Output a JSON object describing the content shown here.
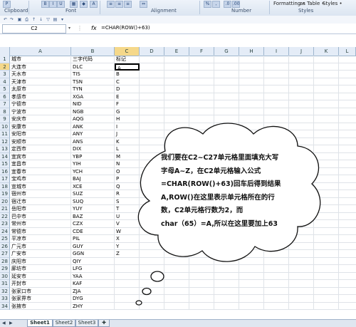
{
  "ribbon": {
    "groups": [
      "Clipboard",
      "Font",
      "Alignment",
      "Number",
      "Styles"
    ],
    "styles_items": [
      "Formatting •",
      "as Table •",
      "Styles •"
    ]
  },
  "formula_bar": {
    "name_box": "C2",
    "fx": "fx",
    "formula": "=CHAR(ROW()+63)"
  },
  "columns": [
    "A",
    "B",
    "C",
    "D",
    "E",
    "F",
    "G",
    "H",
    "I",
    "J",
    "K",
    "L"
  ],
  "rows": [
    {
      "n": "1",
      "a": "城市",
      "b": "三字代码",
      "c": "标记"
    },
    {
      "n": "2",
      "a": "大连市",
      "b": "DLC",
      "c": "A"
    },
    {
      "n": "3",
      "a": "天水市",
      "b": "TIS",
      "c": "B"
    },
    {
      "n": "4",
      "a": "天津市",
      "b": "TSN",
      "c": "C"
    },
    {
      "n": "5",
      "a": "太原市",
      "b": "TYN",
      "c": "D"
    },
    {
      "n": "6",
      "a": "孝感市",
      "b": "XGA",
      "c": "E"
    },
    {
      "n": "7",
      "a": "宁德市",
      "b": "NID",
      "c": "F"
    },
    {
      "n": "8",
      "a": "宁波市",
      "b": "NGB",
      "c": "G"
    },
    {
      "n": "9",
      "a": "安庆市",
      "b": "AQG",
      "c": "H"
    },
    {
      "n": "10",
      "a": "安康市",
      "b": "ANK",
      "c": "I"
    },
    {
      "n": "11",
      "a": "安阳市",
      "b": "ANY",
      "c": "J"
    },
    {
      "n": "12",
      "a": "安顺市",
      "b": "ANS",
      "c": "K"
    },
    {
      "n": "13",
      "a": "定西市",
      "b": "DIX",
      "c": "L"
    },
    {
      "n": "14",
      "a": "宜宾市",
      "b": "YBP",
      "c": "M"
    },
    {
      "n": "15",
      "a": "宜昌市",
      "b": "YIH",
      "c": "N"
    },
    {
      "n": "16",
      "a": "宜春市",
      "b": "YCH",
      "c": "O"
    },
    {
      "n": "17",
      "a": "宝鸡市",
      "b": "BAJ",
      "c": "P"
    },
    {
      "n": "18",
      "a": "宣城市",
      "b": "XCE",
      "c": "Q"
    },
    {
      "n": "19",
      "a": "宿州市",
      "b": "SUZ",
      "c": "R"
    },
    {
      "n": "20",
      "a": "宿迁市",
      "b": "SUQ",
      "c": "S"
    },
    {
      "n": "21",
      "a": "岳阳市",
      "b": "YUY",
      "c": "T"
    },
    {
      "n": "22",
      "a": "巴中市",
      "b": "BAZ",
      "c": "U"
    },
    {
      "n": "23",
      "a": "常州市",
      "b": "CZX",
      "c": "V"
    },
    {
      "n": "24",
      "a": "常德市",
      "b": "CDE",
      "c": "W"
    },
    {
      "n": "25",
      "a": "平凉市",
      "b": "PIL",
      "c": "X"
    },
    {
      "n": "26",
      "a": "广元市",
      "b": "GUY",
      "c": "Y"
    },
    {
      "n": "27",
      "a": "广安市",
      "b": "GGN",
      "c": "Z"
    },
    {
      "n": "28",
      "a": "庆阳市",
      "b": "QIY",
      "c": ""
    },
    {
      "n": "29",
      "a": "廊坊市",
      "b": "LFG",
      "c": ""
    },
    {
      "n": "30",
      "a": "延安市",
      "b": "YAA",
      "c": ""
    },
    {
      "n": "31",
      "a": "开封市",
      "b": "KAF",
      "c": ""
    },
    {
      "n": "32",
      "a": "张家口市",
      "b": "ZJA",
      "c": ""
    },
    {
      "n": "33",
      "a": "张家界市",
      "b": "DYG",
      "c": ""
    },
    {
      "n": "34",
      "a": "张掖市",
      "b": "ZHY",
      "c": ""
    }
  ],
  "sheets": [
    "Sheet1",
    "Sheet2",
    "Sheet3"
  ],
  "callout": {
    "lines": [
      "我们要在C2~C27单元格里面填充大写",
      "字母A~Z，在C2单元格输入公式",
      "=CHAR(ROW()+63)回车后得到结果",
      "A,ROW()在这里表示单元格所在的行",
      "数，C2单元格行数为2，而",
      "char（65）=A,所以在这里要加上63"
    ]
  },
  "colors": {
    "selection": "#000000",
    "header_bg": "#e4ecf7",
    "grid": "#dfe3e8"
  }
}
